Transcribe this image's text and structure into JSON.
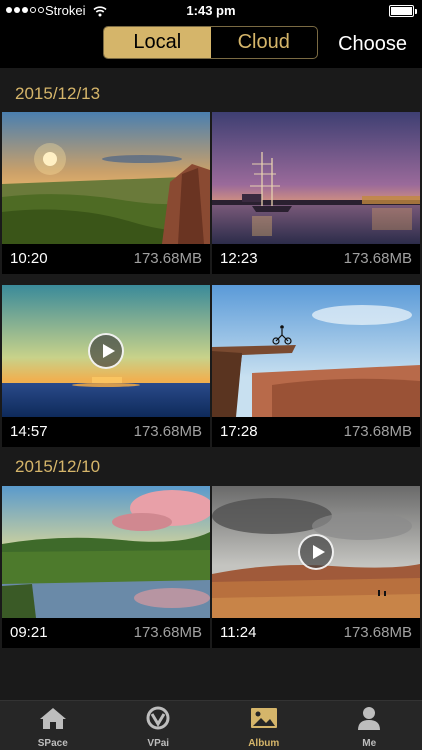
{
  "status_bar": {
    "carrier": "Strokei",
    "time": "1:43 pm"
  },
  "nav": {
    "segments": [
      "Local",
      "Cloud"
    ],
    "selected": "Local",
    "choose_label": "Choose"
  },
  "colors": {
    "accent": "#d5b56a"
  },
  "groups": [
    {
      "date": "2015/12/13",
      "items": [
        {
          "time": "10:20",
          "size": "173.68MB",
          "video": false,
          "scene": "sunset-valley"
        },
        {
          "time": "12:23",
          "size": "173.68MB",
          "video": false,
          "scene": "harbor-ship-night"
        },
        {
          "time": "14:57",
          "size": "173.68MB",
          "video": true,
          "scene": "ocean-sunset"
        },
        {
          "time": "17:28",
          "size": "173.68MB",
          "video": false,
          "scene": "cliff-cyclist"
        }
      ]
    },
    {
      "date": "2015/12/10",
      "items": [
        {
          "time": "09:21",
          "size": "173.68MB",
          "video": false,
          "scene": "lake-hills-clouds"
        },
        {
          "time": "11:24",
          "size": "173.68MB",
          "video": true,
          "scene": "desert-cloudy-sky"
        }
      ]
    }
  ],
  "tabbar": {
    "tabs": [
      {
        "label": "SPace",
        "icon": "home-icon"
      },
      {
        "label": "VPai",
        "icon": "camera-lens-icon"
      },
      {
        "label": "Album",
        "icon": "image-icon"
      },
      {
        "label": "Me",
        "icon": "person-icon"
      }
    ],
    "selected": "Album"
  }
}
